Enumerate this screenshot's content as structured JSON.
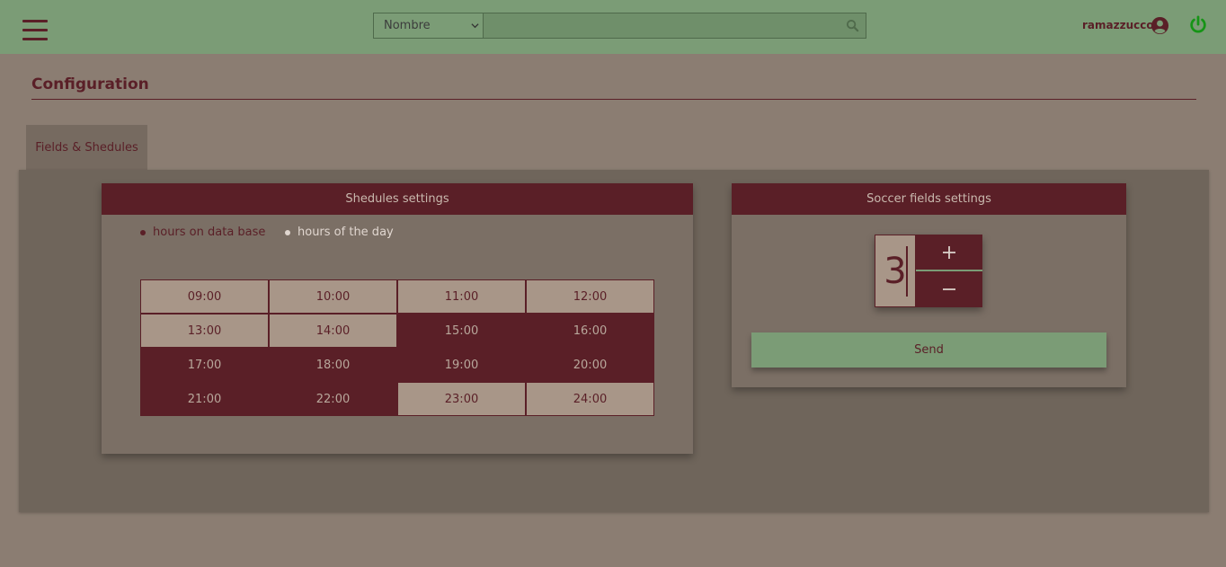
{
  "topbar": {
    "search_select_value": "Nombre",
    "search_placeholder": "",
    "user_name": "ramazzucco",
    "icons": {
      "menu": "hamburger-icon",
      "search": "search-icon",
      "user": "user-circle-icon",
      "power": "power-icon"
    }
  },
  "page": {
    "title": "Configuration"
  },
  "tabs": [
    {
      "label": "Fields & Shedules"
    }
  ],
  "schedules": {
    "title": "Shedules settings",
    "radio_db": "hours on data base",
    "radio_day": "hours of the day",
    "hours": [
      {
        "label": "09:00",
        "active": false
      },
      {
        "label": "10:00",
        "active": false
      },
      {
        "label": "11:00",
        "active": false
      },
      {
        "label": "12:00",
        "active": false
      },
      {
        "label": "13:00",
        "active": false
      },
      {
        "label": "14:00",
        "active": false
      },
      {
        "label": "15:00",
        "active": true
      },
      {
        "label": "16:00",
        "active": true
      },
      {
        "label": "17:00",
        "active": true
      },
      {
        "label": "18:00",
        "active": true
      },
      {
        "label": "19:00",
        "active": true
      },
      {
        "label": "20:00",
        "active": true
      },
      {
        "label": "21:00",
        "active": true
      },
      {
        "label": "22:00",
        "active": true
      },
      {
        "label": "23:00",
        "active": false
      },
      {
        "label": "24:00",
        "active": false
      }
    ]
  },
  "fields": {
    "title": "Soccer fields settings",
    "count": "3",
    "send_label": "Send"
  },
  "colors": {
    "topbar": "#7b9c76",
    "accent": "#5a1f27",
    "background": "#8b7d72",
    "panel": "#6f655b",
    "power": "#1a9a1a"
  }
}
